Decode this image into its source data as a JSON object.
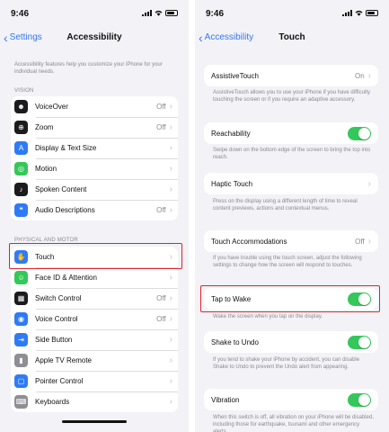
{
  "left": {
    "time": "9:46",
    "back_label": "Settings",
    "title": "Accessibility",
    "intro": "Accessibility features help you customize your iPhone for your individual needs.",
    "vision_header": "VISION",
    "vision_items": [
      {
        "label": "VoiceOver",
        "value": "Off",
        "icon": "voiceover-icon",
        "color": "#1c1c1e",
        "glyph": "☻"
      },
      {
        "label": "Zoom",
        "value": "Off",
        "icon": "zoom-icon",
        "color": "#1c1c1e",
        "glyph": "⊕"
      },
      {
        "label": "Display & Text Size",
        "value": "",
        "icon": "text-size-icon",
        "color": "#2f7bf5",
        "glyph": "A"
      },
      {
        "label": "Motion",
        "value": "",
        "icon": "motion-icon",
        "color": "#34c759",
        "glyph": "◎"
      },
      {
        "label": "Spoken Content",
        "value": "",
        "icon": "spoken-content-icon",
        "color": "#1c1c1e",
        "glyph": "♪"
      },
      {
        "label": "Audio Descriptions",
        "value": "Off",
        "icon": "audio-descriptions-icon",
        "color": "#2f7bf5",
        "glyph": "❝"
      }
    ],
    "physical_header": "PHYSICAL AND MOTOR",
    "physical_items": [
      {
        "label": "Touch",
        "value": "",
        "icon": "touch-hand-icon",
        "color": "#2f7bf5",
        "glyph": "✋"
      },
      {
        "label": "Face ID & Attention",
        "value": "",
        "icon": "face-id-icon",
        "color": "#34c759",
        "glyph": "☺"
      },
      {
        "label": "Switch Control",
        "value": "Off",
        "icon": "switch-control-icon",
        "color": "#1c1c1e",
        "glyph": "▦"
      },
      {
        "label": "Voice Control",
        "value": "Off",
        "icon": "voice-control-icon",
        "color": "#2f7bf5",
        "glyph": "◉"
      },
      {
        "label": "Side Button",
        "value": "",
        "icon": "side-button-icon",
        "color": "#2f7bf5",
        "glyph": "⇥"
      },
      {
        "label": "Apple TV Remote",
        "value": "",
        "icon": "tv-remote-icon",
        "color": "#8e8e93",
        "glyph": "▮"
      },
      {
        "label": "Pointer Control",
        "value": "",
        "icon": "pointer-control-icon",
        "color": "#2f7bf5",
        "glyph": "▢"
      },
      {
        "label": "Keyboards",
        "value": "",
        "icon": "keyboard-icon",
        "color": "#8e8e93",
        "glyph": "⌨"
      }
    ]
  },
  "right": {
    "time": "9:46",
    "back_label": "Accessibility",
    "title": "Touch",
    "assistive": {
      "label": "AssistiveTouch",
      "value": "On",
      "desc": "AssistiveTouch allows you to use your iPhone if you have difficulty touching the screen or if you require an adaptive accessory."
    },
    "reachability": {
      "label": "Reachability",
      "desc": "Swipe down on the bottom edge of the screen to bring the top into reach."
    },
    "haptic": {
      "label": "Haptic Touch",
      "desc": "Press on the display using a different length of time to reveal content previews, actions and contextual menus."
    },
    "accommodations": {
      "label": "Touch Accommodations",
      "value": "Off",
      "desc": "If you have trouble using the touch screen, adjust the following settings to change how the screen will respond to touches."
    },
    "tap_to_wake": {
      "label": "Tap to Wake",
      "desc": "Wake the screen when you tap on the display."
    },
    "shake": {
      "label": "Shake to Undo",
      "desc": "If you tend to shake your iPhone by accident, you can disable Shake to Undo to prevent the Undo alert from appearing."
    },
    "vibration": {
      "label": "Vibration",
      "desc": "When this switch is off, all vibration on your iPhone will be disabled, including those for earthquake, tsunami and other emergency alerts."
    }
  },
  "colors": {
    "accent": "#3478f6",
    "toggle_on": "#34c759",
    "highlight": "#e0232f"
  }
}
